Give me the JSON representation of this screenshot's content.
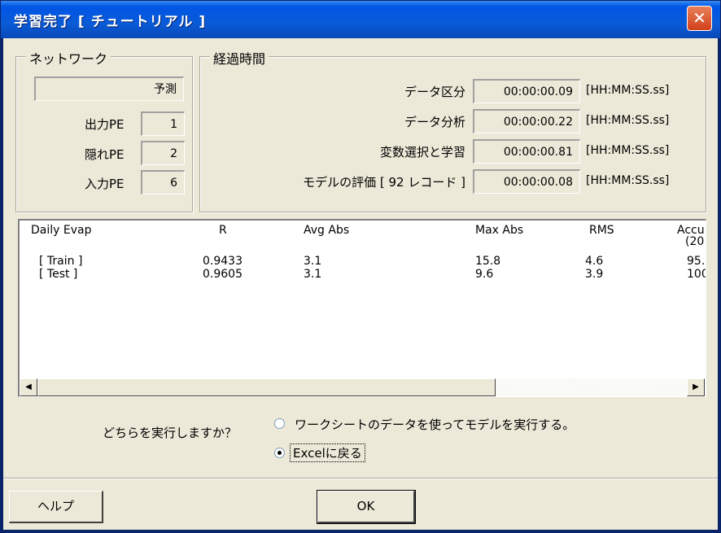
{
  "window": {
    "title": "学習完了 [ チュートリアル ]",
    "close_glyph": "✕"
  },
  "network": {
    "legend": "ネットワーク",
    "mode_value": "予測",
    "output_label": "出力PE",
    "output_value": "1",
    "hidden_label": "隠れPE",
    "hidden_value": "2",
    "input_label": "入力PE",
    "input_value": "6"
  },
  "elapsed": {
    "legend": "経過時間",
    "rows": [
      {
        "label": "データ区分",
        "value": "00:00:00.09",
        "unit": "[HH:MM:SS.ss]"
      },
      {
        "label": "データ分析",
        "value": "00:00:00.22",
        "unit": "[HH:MM:SS.ss]"
      },
      {
        "label": "変数選択と学習",
        "value": "00:00:00.81",
        "unit": "[HH:MM:SS.ss]"
      },
      {
        "label": "モデルの評価 [ 92 レコード ]",
        "value": "00:00:00.08",
        "unit": "[HH:MM:SS.ss]"
      }
    ]
  },
  "results": {
    "headers": [
      "Daily Evap",
      "R",
      "Avg Abs",
      "Max Abs",
      "RMS",
      "Accu",
      "(20"
    ],
    "rows": [
      [
        "[ Train ]",
        "0.9433",
        "3.1",
        "15.8",
        "4.6",
        "95."
      ],
      [
        "[  Test ]",
        "0.9605",
        "3.1",
        "9.6",
        "3.9",
        "100"
      ]
    ],
    "scroll_left_glyph": "◀",
    "scroll_right_glyph": "▶"
  },
  "choice": {
    "question": "どちらを実行しますか？",
    "option_run": "ワークシートのデータを使ってモデルを実行する。",
    "option_excel": "Excelに戻る",
    "selected": "option_excel"
  },
  "buttons": {
    "help": "ヘルプ",
    "ok": "OK"
  }
}
